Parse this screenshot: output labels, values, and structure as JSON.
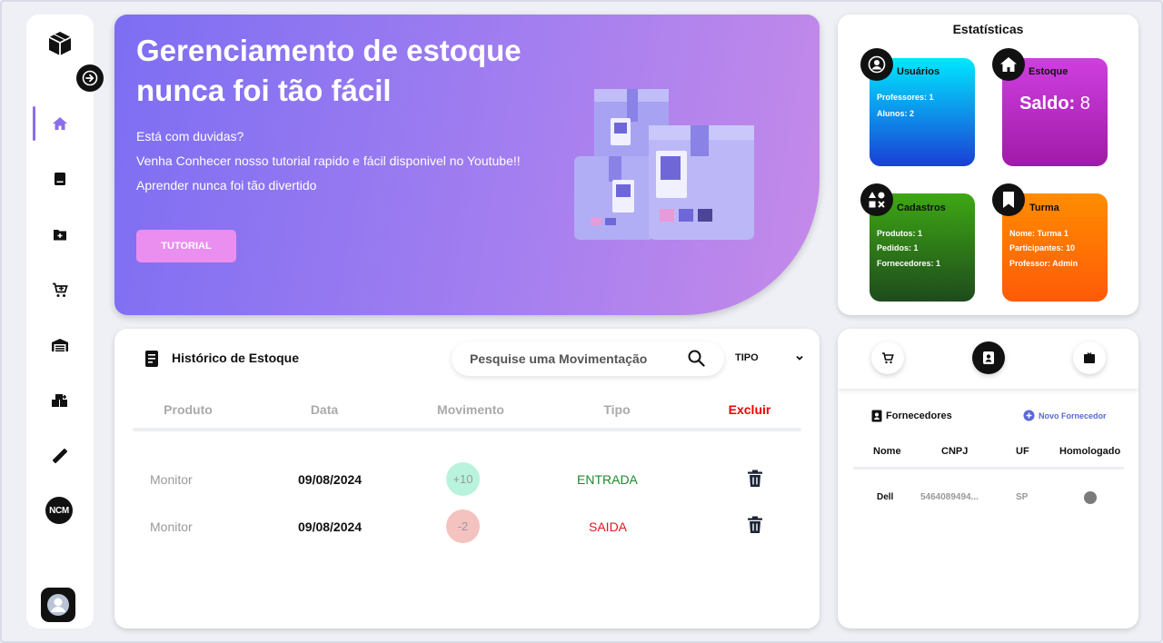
{
  "hero": {
    "title": "Gerenciamento de estoque nunca foi tão fácil",
    "lines": [
      "Está com duvidas?",
      "Venha Conhecer nosso tutorial rapido e fácil disponivel no Youtube!!",
      "Aprender nunca foi tão divertido"
    ],
    "button": "TUTORIAL"
  },
  "sidebar": {
    "ncm_label": "NCM",
    "items": [
      "home-icon",
      "book-icon",
      "folder-add-icon",
      "cart-add-icon",
      "warehouse-icon",
      "boxes-icon",
      "ruler-icon"
    ]
  },
  "stats": {
    "title": "Estatísticas",
    "usuarios": {
      "title": "Usuários",
      "lines": [
        "Professores: 1",
        "Alunos: 2"
      ],
      "color": "#00e5ff"
    },
    "estoque": {
      "title": "Estoque",
      "saldo_label": "Saldo:",
      "saldo_value": "8",
      "color": "#c234d6"
    },
    "cadastros": {
      "title": "Cadastros",
      "lines": [
        "Produtos: 1",
        "Pedidos: 1",
        "Fornecedores: 1"
      ],
      "color": "#3a9a13"
    },
    "turma": {
      "title": "Turma",
      "lines": [
        "Nome: Turma 1",
        "Participantes: 10",
        "Professor: Admin"
      ],
      "color": "#ff8a00"
    }
  },
  "history": {
    "title": "Histórico de Estoque",
    "search_placeholder": "Pesquise uma Movimentação",
    "tipo_label": "TIPO",
    "columns": [
      "Produto",
      "Data",
      "Movimento",
      "Tipo",
      "Excluir"
    ],
    "rows": [
      {
        "produto": "Monitor",
        "data": "09/08/2024",
        "movimento": "+10",
        "tipo": "ENTRADA"
      },
      {
        "produto": "Monitor",
        "data": "09/08/2024",
        "movimento": "-2",
        "tipo": "SAIDA"
      }
    ]
  },
  "suppliers": {
    "title": "Fornecedores",
    "new_label": "Novo Fornecedor",
    "columns": [
      "Nome",
      "CNPJ",
      "UF",
      "Homologado"
    ],
    "rows": [
      {
        "nome": "Dell",
        "cnpj": "5464089494...",
        "uf": "SP"
      }
    ]
  }
}
